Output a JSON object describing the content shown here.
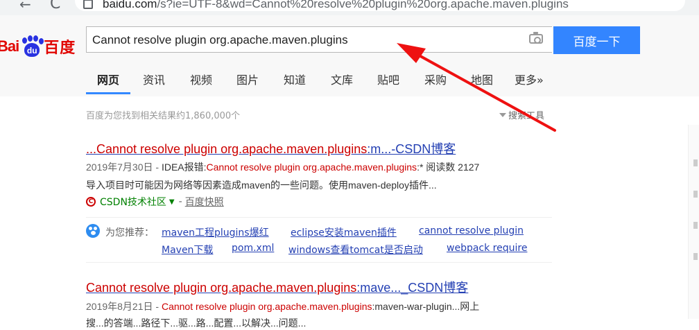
{
  "browser": {
    "url_host": "baidu.com",
    "url_rest": "/s?ie=UTF-8&wd=Cannot%20resolve%20plugin%20org.apache.maven.plugins"
  },
  "header": {
    "logo_bai": "Bai",
    "logo_du": "du",
    "logo_cn": "百度",
    "query": "Cannot resolve plugin org.apache.maven.plugins",
    "search_button": "百度一下"
  },
  "tabs": [
    {
      "label": "网页",
      "active": true
    },
    {
      "label": "资讯"
    },
    {
      "label": "视频"
    },
    {
      "label": "图片"
    },
    {
      "label": "知道"
    },
    {
      "label": "文库"
    },
    {
      "label": "贴吧"
    },
    {
      "label": "采购"
    },
    {
      "label": "地图"
    },
    {
      "label": "更多»"
    }
  ],
  "results_meta": {
    "count_text": "百度为您找到相关结果约1,860,000个",
    "tools_text": "搜索工具"
  },
  "results": [
    {
      "title_hl": "...Cannot resolve plugin org.apache.maven.plugins",
      "title_rest": ":m...-CSDN博客",
      "date": "2019年7月30日 - ",
      "snippet1_a": "IDEA报错:",
      "snippet1_hl": "Cannot resolve plugin org.apache.maven.plugins",
      "snippet1_b": ":* 阅读数 2127",
      "snippet2": "导入项目时可能因为网络等因素造成maven的一些问题。使用maven-deploy插件...",
      "source_icon": "C",
      "source_site": "CSDN技术社区",
      "source_caret": "▼",
      "source_sep": "-",
      "source_snapshot": "百度快照"
    },
    {
      "title_hl": "Cannot resolve plugin org.apache.maven.plugins",
      "title_rest": ":mave..._CSDN博客",
      "date": "2019年8月21日 - ",
      "snippet1_hl": "Cannot resolve plugin org.apache.maven.plugins",
      "snippet1_b": ":maven-war-plugin...网上",
      "snippet2": "搜...的答端...路径下...驱...路...配置...以解决...问题..."
    }
  ],
  "recommend": {
    "label": "为您推荐：",
    "links": [
      "maven工程plugins爆红",
      "eclipse安装maven插件",
      "cannot resolve plugin",
      "Maven下载",
      "pom.xml",
      "windows查看tomcat是否启动",
      "webpack require"
    ]
  },
  "colors": {
    "accent": "#3385ff",
    "link": "#2440b3",
    "highlight": "#cc0000",
    "source_green": "#008000",
    "annotation_arrow": "#ee1111"
  }
}
